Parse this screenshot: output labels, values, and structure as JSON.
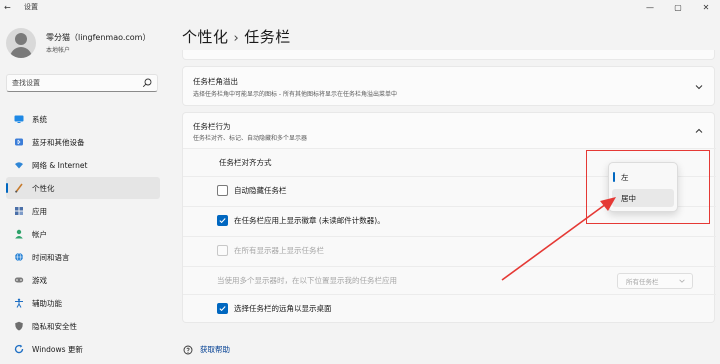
{
  "window": {
    "app_title": "设置",
    "back_glyph": "←",
    "minimize_glyph": "—",
    "maximize_glyph": "▢",
    "close_glyph": "✕"
  },
  "profile": {
    "name": "零分猫（lingfenmao.com）",
    "account_type": "本地帐户"
  },
  "search": {
    "placeholder": "查找设置"
  },
  "nav": {
    "items": [
      {
        "label": "系统",
        "icon": "monitor-icon"
      },
      {
        "label": "蓝牙和其他设备",
        "icon": "bluetooth-icon"
      },
      {
        "label": "网络 & Internet",
        "icon": "wifi-icon"
      },
      {
        "label": "个性化",
        "icon": "brush-icon"
      },
      {
        "label": "应用",
        "icon": "apps-icon"
      },
      {
        "label": "帐户",
        "icon": "person-icon"
      },
      {
        "label": "时间和语言",
        "icon": "globe-icon"
      },
      {
        "label": "游戏",
        "icon": "gamepad-icon"
      },
      {
        "label": "辅助功能",
        "icon": "accessibility-icon"
      },
      {
        "label": "隐私和安全性",
        "icon": "shield-icon"
      },
      {
        "label": "Windows 更新",
        "icon": "update-icon"
      }
    ],
    "active_index": 3
  },
  "breadcrumb": {
    "parent": "个性化",
    "separator": "›",
    "current": "任务栏"
  },
  "sections": {
    "overflow": {
      "title": "任务栏角溢出",
      "subtitle": "选择任务栏角中可能显示的图标 - 所有其他图标将显示在任务栏角溢出菜单中"
    },
    "behavior": {
      "title": "任务栏行为",
      "subtitle": "任务栏对齐、标记、自动隐藏和多个显示器"
    }
  },
  "behavior_rows": {
    "alignment_label": "任务栏对齐方式",
    "auto_hide": {
      "label": "自动隐藏任务栏",
      "checked": false,
      "disabled": false
    },
    "badges": {
      "label": "在任务栏应用上显示徽章 (未读邮件计数器)。",
      "checked": true,
      "disabled": false
    },
    "all_displays": {
      "label": "在所有显示器上显示任务栏",
      "checked": false,
      "disabled": true
    },
    "multi_display_label": "当使用多个显示器时，在以下位置显示我的任务栏应用",
    "multi_display_value": "所有任务栏",
    "far_corner": {
      "label": "选择任务栏的远角以显示桌面",
      "checked": true,
      "disabled": false
    }
  },
  "alignment_dropdown": {
    "options": [
      "左",
      "居中"
    ],
    "selected_index": 0,
    "hover_index": 1
  },
  "help": {
    "label": "获取帮助"
  },
  "colors": {
    "accent": "#0067c0",
    "annotation": "#e53935"
  }
}
